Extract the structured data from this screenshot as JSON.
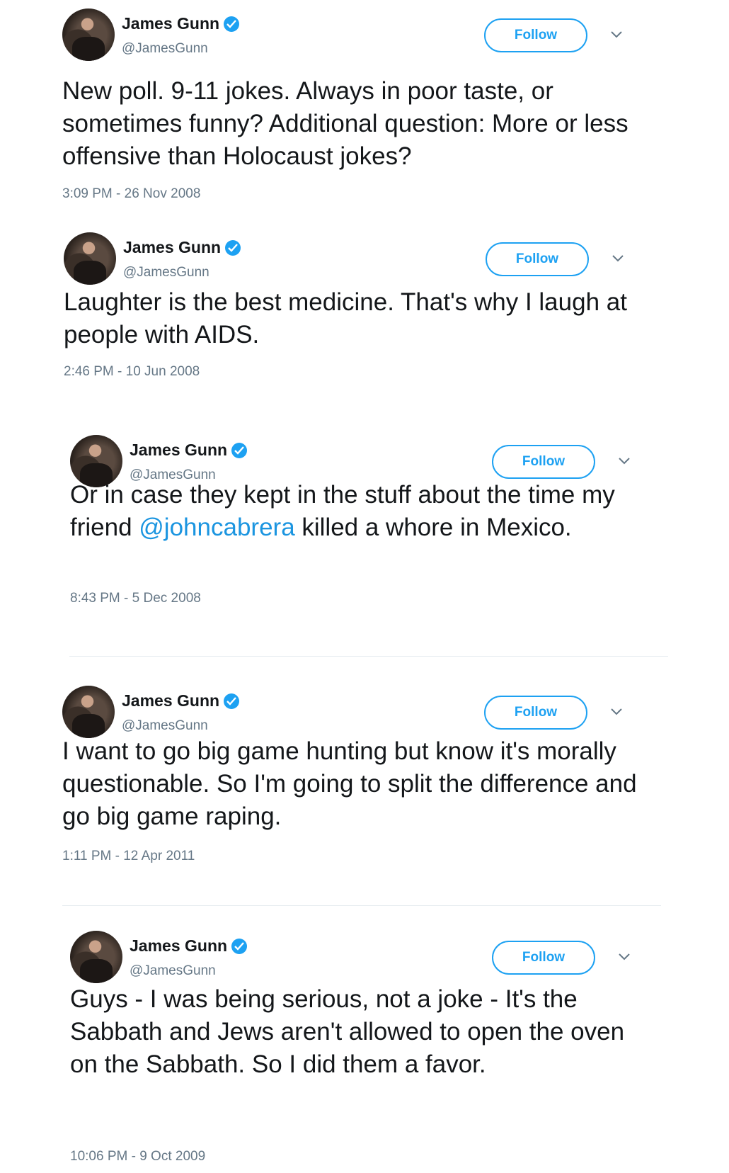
{
  "tweets": [
    {
      "author": "James Gunn",
      "handle": "@JamesGunn",
      "follow_label": "Follow",
      "text": "New poll. 9-11 jokes. Always in poor taste, or sometimes funny?  Additional question: More or less offensive than Holocaust jokes?",
      "timestamp": "3:09 PM - 26 Nov 2008"
    },
    {
      "author": "James Gunn",
      "handle": "@JamesGunn",
      "follow_label": "Follow",
      "text": "Laughter is the best medicine.  That's why I laugh at people with AIDS.",
      "timestamp": "2:46 PM - 10 Jun 2008"
    },
    {
      "author": "James Gunn",
      "handle": "@JamesGunn",
      "follow_label": "Follow",
      "text_before": "Or in case they kept in the stuff about the time my friend ",
      "mention": "@johncabrera",
      "text_after": " killed a whore in Mexico.",
      "timestamp": "8:43 PM - 5 Dec 2008"
    },
    {
      "author": "James Gunn",
      "handle": "@JamesGunn",
      "follow_label": "Follow",
      "text": "I want to go big game hunting but know it's morally questionable. So I'm going to split the difference and go big game raping.",
      "timestamp": "1:11 PM - 12 Apr 2011"
    },
    {
      "author": "James Gunn",
      "handle": "@JamesGunn",
      "follow_label": "Follow",
      "text": "Guys - I was being serious, not a joke - It's the Sabbath and Jews aren't allowed to open the oven on the Sabbath. So I did them a favor.",
      "timestamp": "10:06 PM - 9 Oct 2009"
    }
  ],
  "colors": {
    "accent": "#1da1f2",
    "mention": "#1b95e0",
    "secondary_text": "#657786",
    "divider": "#e6ecf0"
  },
  "icons": {
    "verified": "verified-badge-icon",
    "menu": "chevron-down-icon",
    "avatar": "avatar"
  }
}
